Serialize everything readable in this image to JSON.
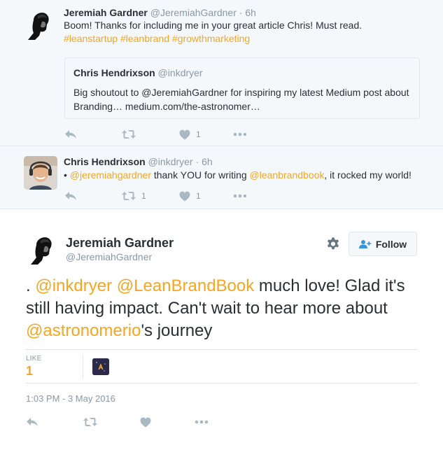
{
  "tweets": [
    {
      "name": "Jeremiah Gardner",
      "handle": "@JeremiahGardner",
      "time": "6h",
      "text": "Boom! Thanks for including me in your great article Chris! Must read.",
      "hashtags": "#leanstartup #leanbrand #growthmarketing",
      "quote": {
        "name": "Chris Hendrixson",
        "handle": "@inkdryer",
        "text": "Big shoutout to @JeremiahGardner for inspiring my latest Medium post about Branding… medium.com/the-astronomer…"
      },
      "like_count": "1"
    },
    {
      "name": "Chris Hendrixson",
      "handle": "@inkdryer",
      "time": "6h",
      "bullet": "•",
      "mention1": "@jeremiahgardner",
      "text1": "thank YOU for writing",
      "mention2": "@leanbrandbook",
      "text2": ", it rocked my world!",
      "retweet_count": "1",
      "like_count": "1"
    }
  ],
  "main": {
    "name": "Jeremiah Gardner",
    "handle": "@JeremiahGardner",
    "follow_label": "Follow",
    "text_prefix": ". ",
    "mention1": "@inkdryer",
    "mention2": "@LeanBrandBook",
    "text_mid": " much love! Glad it's still having impact. Can't wait to hear more about ",
    "mention3": "@astronomerio",
    "text_end": "'s journey",
    "likes_label": "LIKE",
    "likes_count": "1",
    "timestamp": "1:03 PM - 3 May 2016"
  },
  "colors": {
    "link": "#f5a623",
    "background_thread": "#f5f8fa",
    "icon_gray": "#aab8c2"
  }
}
